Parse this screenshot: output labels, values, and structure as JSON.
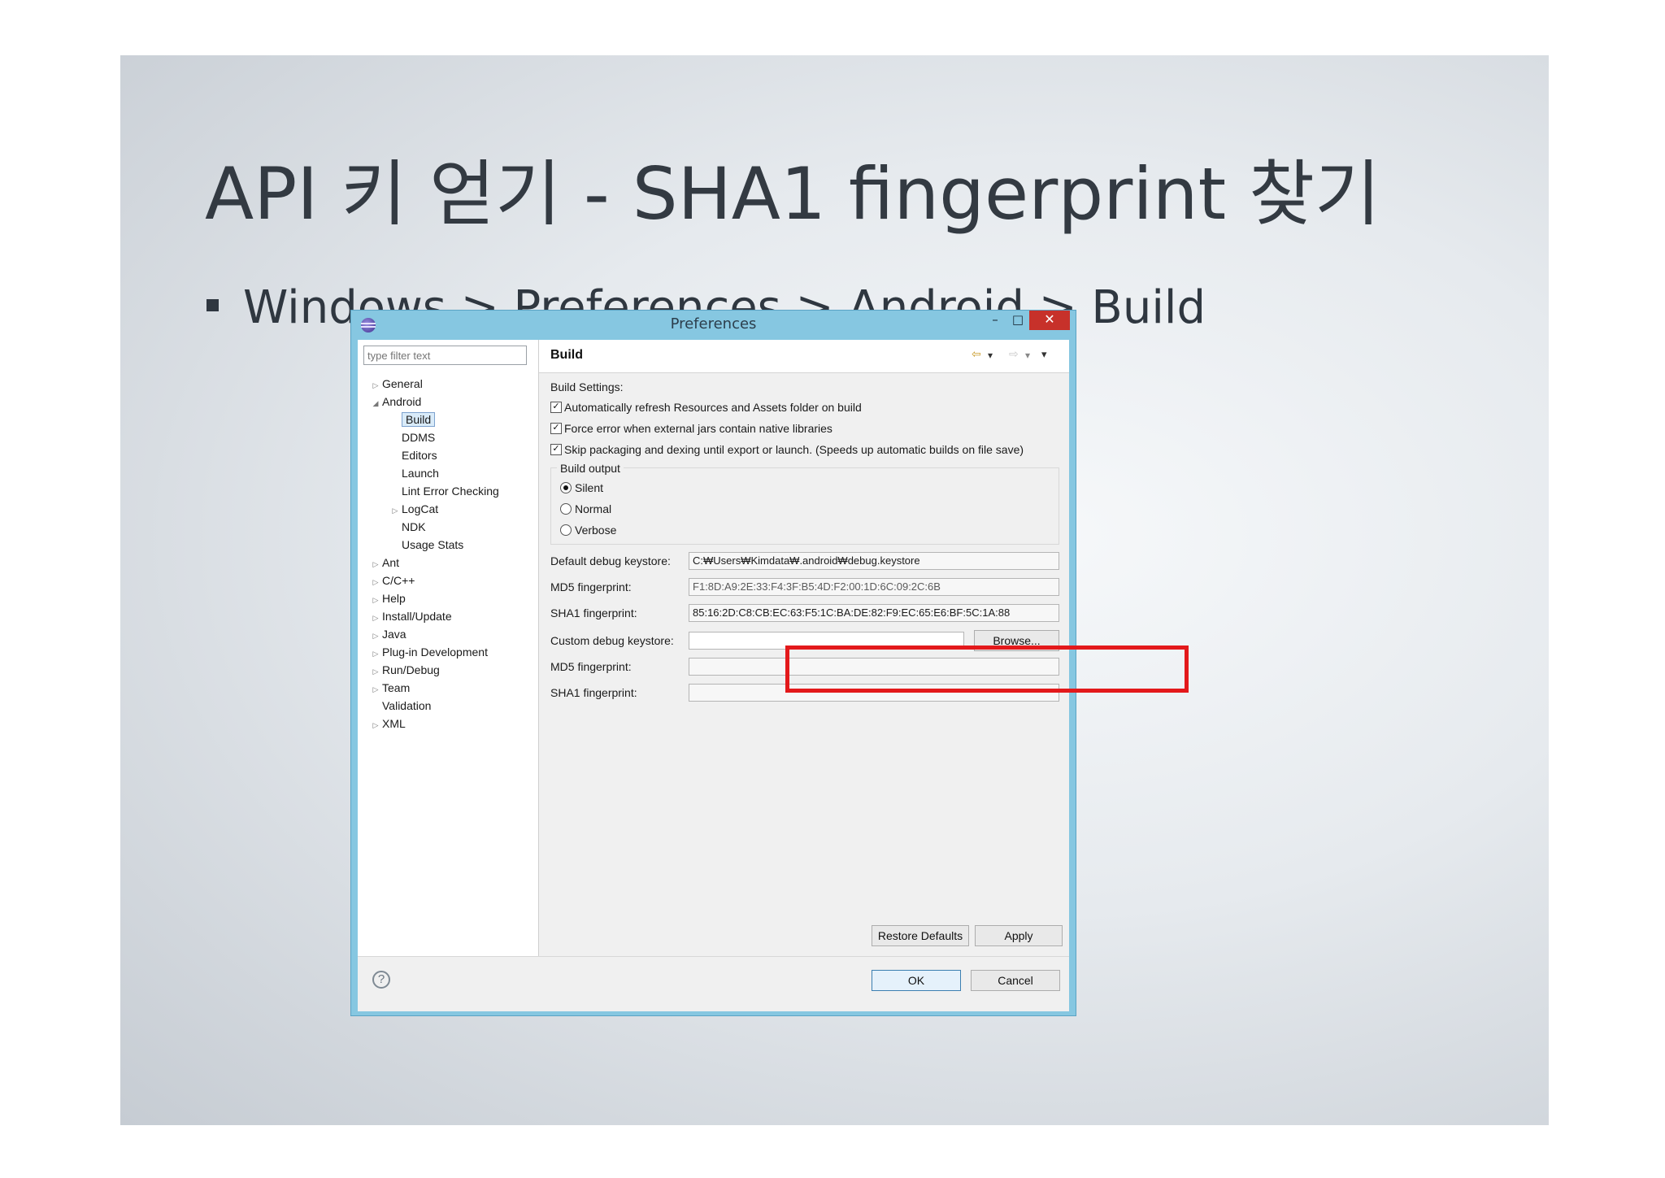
{
  "slide": {
    "title": "API 키 얻기 - SHA1 fingerprint 찾기",
    "bullet": "Windows > Preferences > Android > Build"
  },
  "window": {
    "title": "Preferences",
    "minimize": "–",
    "maximize": "□",
    "close": "✕"
  },
  "tree": {
    "filter_placeholder": "type filter text",
    "items": [
      {
        "label": "General",
        "twisty": "▷"
      },
      {
        "label": "Android",
        "twisty": "◢"
      },
      {
        "label": "Build",
        "twisty": ""
      },
      {
        "label": "DDMS",
        "twisty": ""
      },
      {
        "label": "Editors",
        "twisty": ""
      },
      {
        "label": "Launch",
        "twisty": ""
      },
      {
        "label": "Lint Error Checking",
        "twisty": ""
      },
      {
        "label": "LogCat",
        "twisty": "▷"
      },
      {
        "label": "NDK",
        "twisty": ""
      },
      {
        "label": "Usage Stats",
        "twisty": ""
      },
      {
        "label": "Ant",
        "twisty": "▷"
      },
      {
        "label": "C/C++",
        "twisty": "▷"
      },
      {
        "label": "Help",
        "twisty": "▷"
      },
      {
        "label": "Install/Update",
        "twisty": "▷"
      },
      {
        "label": "Java",
        "twisty": "▷"
      },
      {
        "label": "Plug-in Development",
        "twisty": "▷"
      },
      {
        "label": "Run/Debug",
        "twisty": "▷"
      },
      {
        "label": "Team",
        "twisty": "▷"
      },
      {
        "label": "Validation",
        "twisty": ""
      },
      {
        "label": "XML",
        "twisty": "▷"
      }
    ]
  },
  "page": {
    "title": "Build",
    "nav": {
      "back": "⇦",
      "drop": "▾",
      "forward": "⇨",
      "menu": "▾"
    },
    "settings_label": "Build Settings:",
    "checkboxes": [
      {
        "label": "Automatically refresh Resources and Assets folder on build",
        "mark": "✓"
      },
      {
        "label": "Force error when external jars contain native libraries",
        "mark": "✓"
      },
      {
        "label": "Skip packaging and dexing until export or launch. (Speeds up automatic builds on file save)",
        "mark": "✓"
      }
    ],
    "output": {
      "label": "Build output",
      "options": [
        {
          "label": "Silent",
          "selected": true
        },
        {
          "label": "Normal",
          "selected": false
        },
        {
          "label": "Verbose",
          "selected": false
        }
      ]
    },
    "default_keystore_label": "Default debug keystore:",
    "default_keystore_value": "C:₩Users₩Kimdata₩.android₩debug.keystore",
    "md5_label": "MD5 fingerprint:",
    "md5_value": "F1:8D:A9:2E:33:F4:3F:B5:4D:F2:00:1D:6C:09:2C:6B",
    "sha1_label": "SHA1 fingerprint:",
    "sha1_value": "85:16:2D:C8:CB:EC:63:F5:1C:BA:DE:82:F9:EC:65:E6:BF:5C:1A:88",
    "custom_keystore_label": "Custom debug keystore:",
    "custom_keystore_value": "",
    "browse": "Browse...",
    "custom_md5_label": "MD5 fingerprint:",
    "custom_md5_value": "",
    "custom_sha1_label": "SHA1 fingerprint:",
    "custom_sha1_value": "",
    "restore_defaults": "Restore Defaults",
    "apply": "Apply"
  },
  "footer": {
    "help": "?",
    "ok": "OK",
    "cancel": "Cancel"
  },
  "colors": {
    "highlight": "#e3191b",
    "window_frame": "#86c7e1"
  }
}
